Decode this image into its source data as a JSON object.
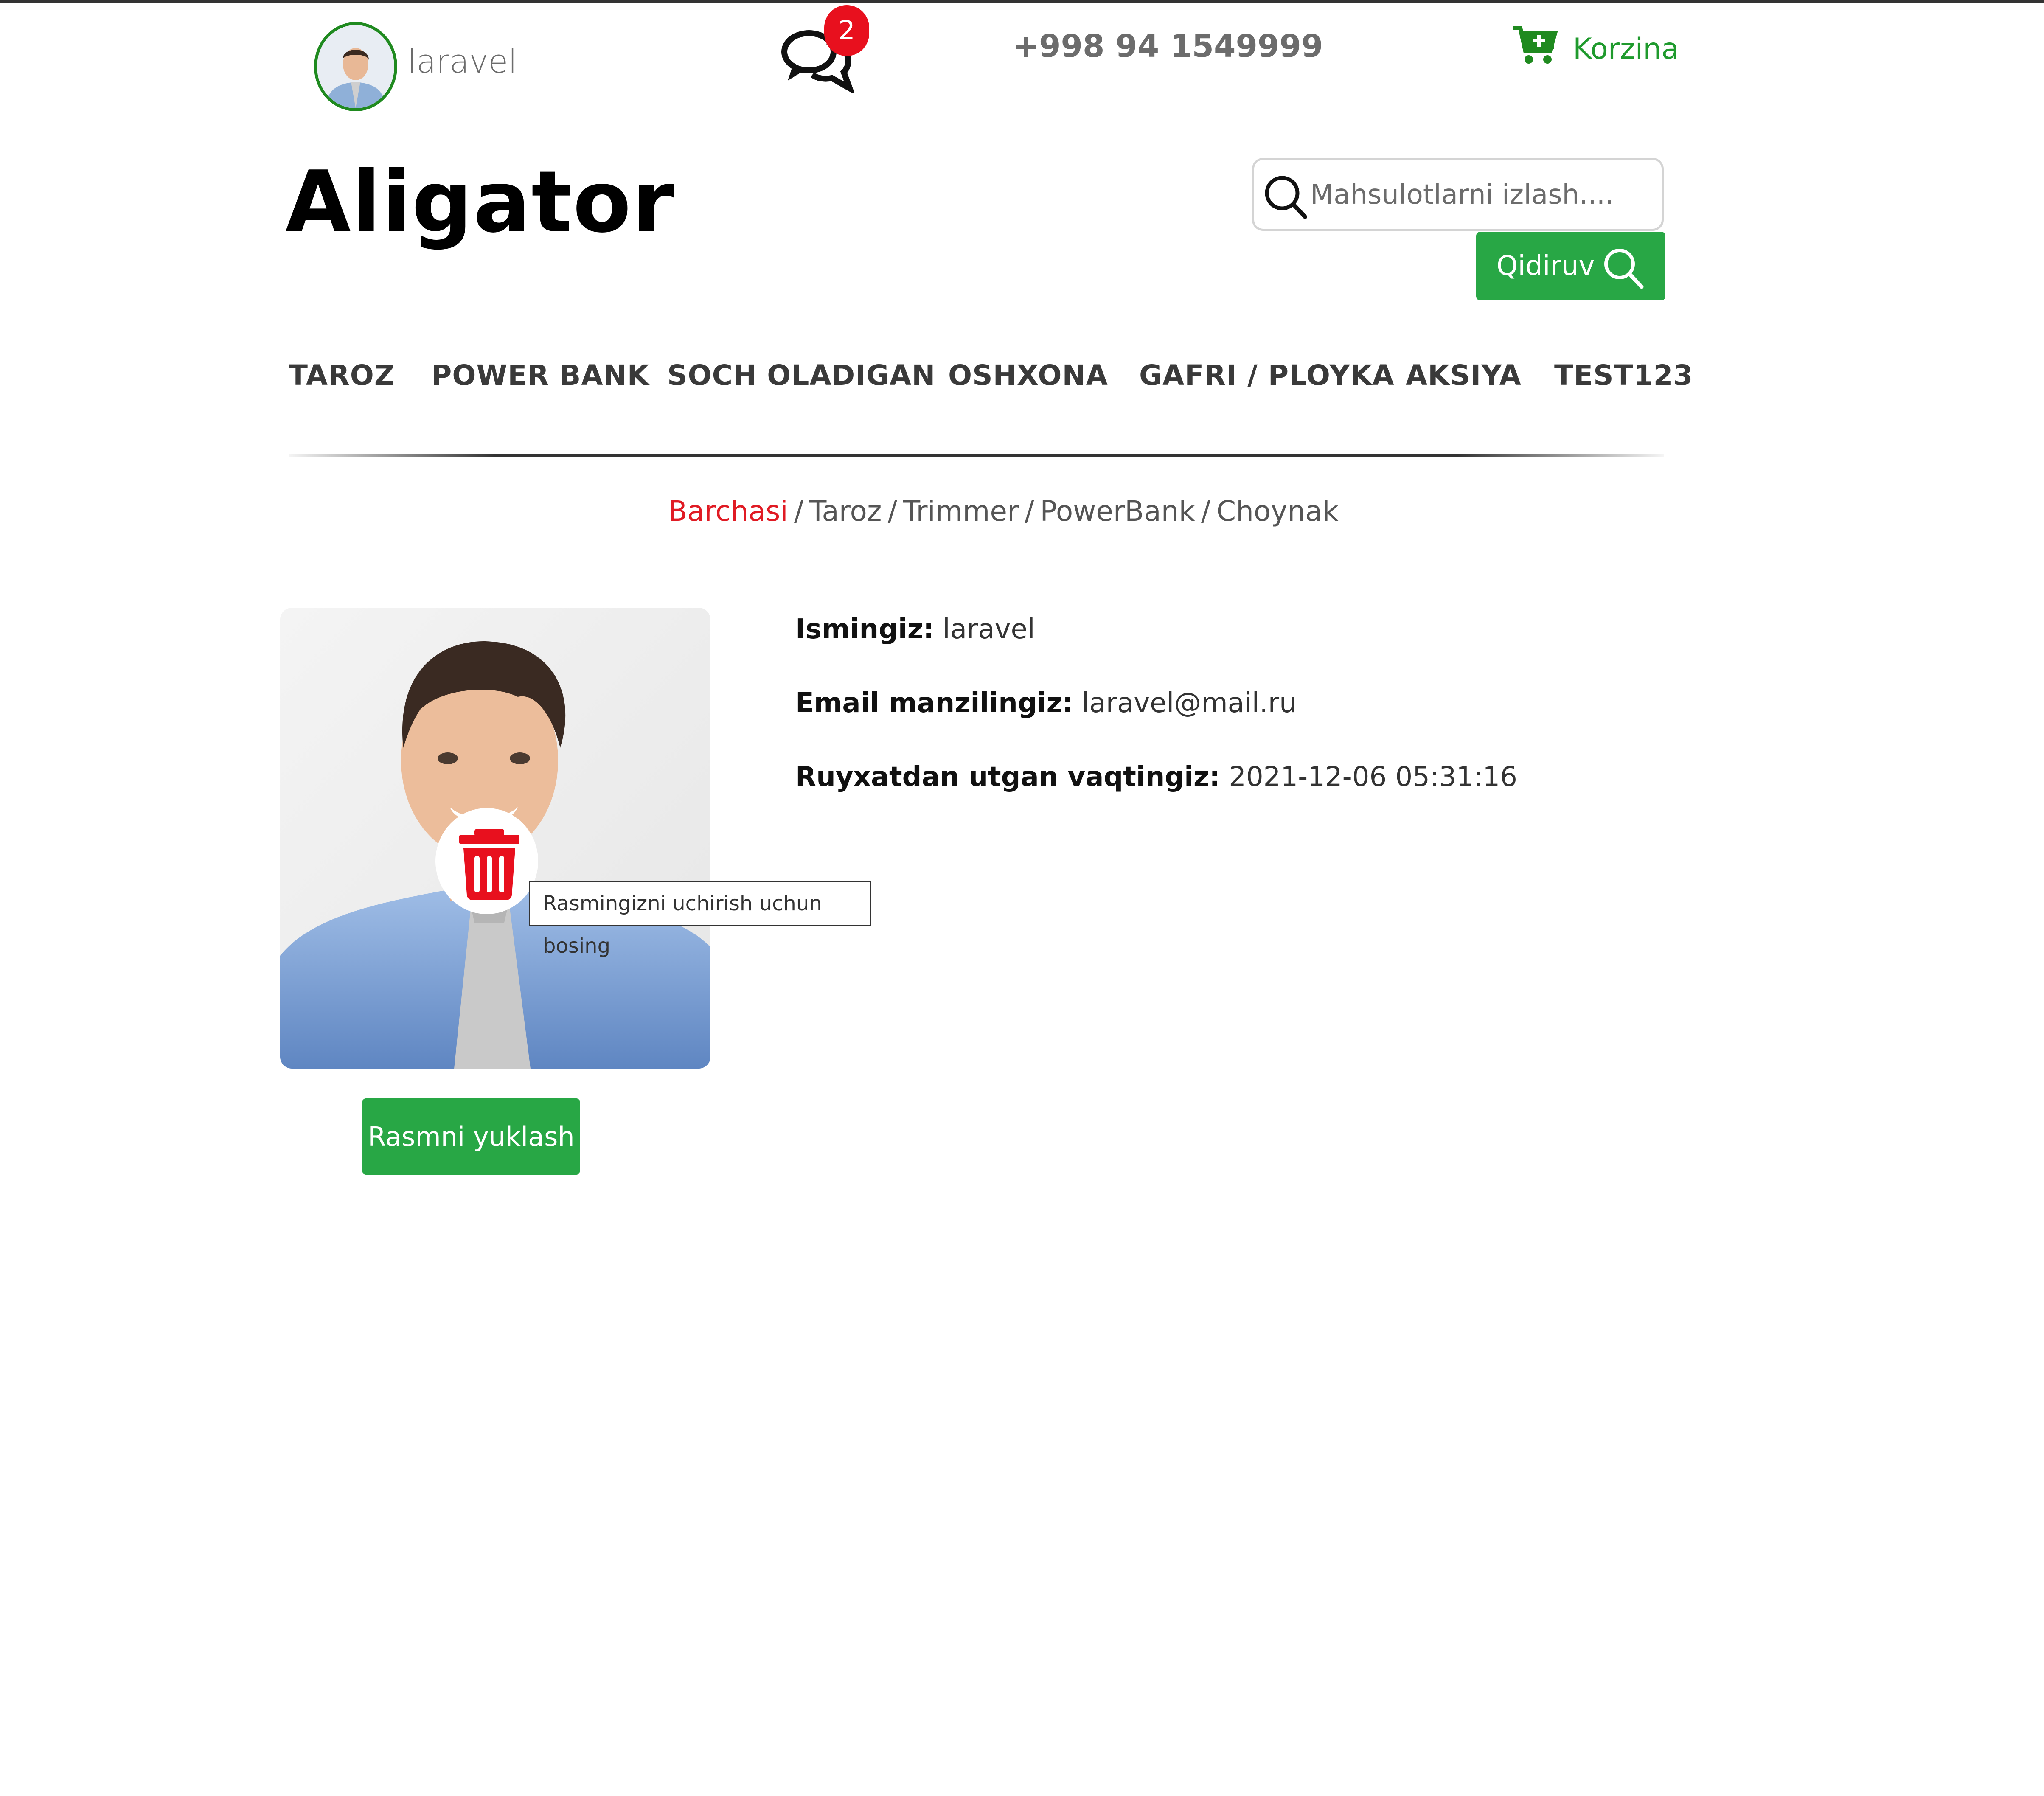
{
  "header": {
    "user_name": "laravel",
    "chat_badge_count": "2",
    "phone": "+998 94 1549999",
    "cart_label": "Korzina",
    "brand": "Aligator",
    "search": {
      "placeholder": "Mahsulotlarni izlash....",
      "button_label": "Qidiruv"
    }
  },
  "nav": {
    "items": [
      "TAROZ",
      "POWER BANK",
      "SOCH OLADIGAN",
      "OSHXONA",
      "GAFRI / PLOYKA",
      "AKSIYA",
      "TEST123"
    ]
  },
  "breadcrumb": {
    "active": "Barchasi",
    "items": [
      "Taroz",
      "Trimmer",
      "PowerBank",
      "Choynak"
    ],
    "separator": "/"
  },
  "profile": {
    "delete_tooltip": "Rasmingizni uchirish uchun bosing",
    "upload_label": "Rasmni yuklash",
    "fields": [
      {
        "label": "Ismingiz:",
        "value": "laravel"
      },
      {
        "label": "Email manzilingiz:",
        "value": "laravel@mail.ru"
      },
      {
        "label": "Ruyxatdan utgan vaqtingiz:",
        "value": "2021-12-06 05:31:16"
      }
    ]
  },
  "colors": {
    "accent_green": "#28a745",
    "badge_red": "#e8101e",
    "breadcrumb_active": "#e01b24",
    "avatar_ring": "#1f8a1f"
  },
  "icons": {
    "chat": "chat-bubbles-icon",
    "cart": "cart-plus-icon",
    "search": "search-icon",
    "delete": "trash-icon"
  }
}
